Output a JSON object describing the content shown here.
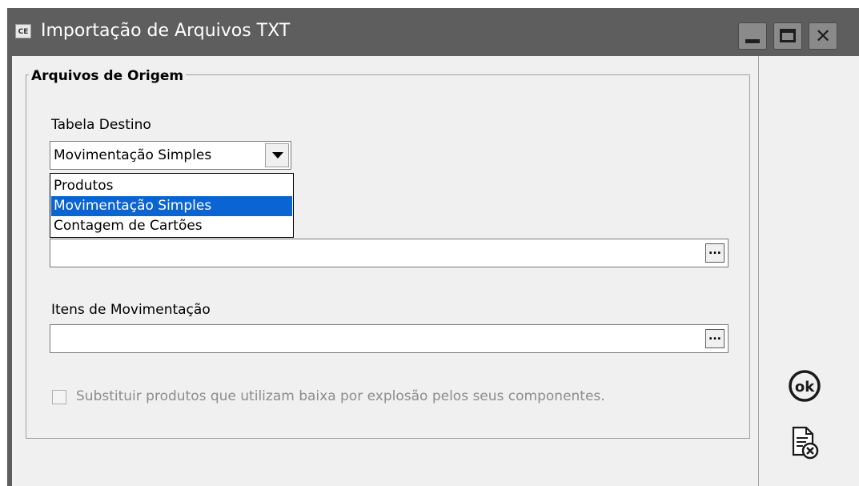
{
  "window": {
    "title": "Importação de Arquivos TXT",
    "app_icon_text": "CE"
  },
  "group": {
    "title": "Arquivos de Origem"
  },
  "tabela_destino": {
    "label": "Tabela Destino",
    "selected": "Movimentação Simples",
    "options": [
      "Produtos",
      "Movimentação Simples",
      "Contagem de Cartões"
    ],
    "highlighted_index": 1
  },
  "arquivo_field": {
    "value": "",
    "button_label": "..."
  },
  "itens": {
    "label": "Itens de Movimentação",
    "value": "",
    "button_label": "..."
  },
  "checkbox": {
    "label": "Substituir produtos que utilizam baixa por explosão pelos seus componentes.",
    "checked": false,
    "enabled": false
  },
  "actions": {
    "ok_label": "ok",
    "ok_icon": "ok-icon",
    "cancel_icon": "cancel-document-icon"
  },
  "colors": {
    "titlebar": "#5e5e5e",
    "selection": "#0a64d2",
    "client_bg": "#f0f0f0"
  }
}
